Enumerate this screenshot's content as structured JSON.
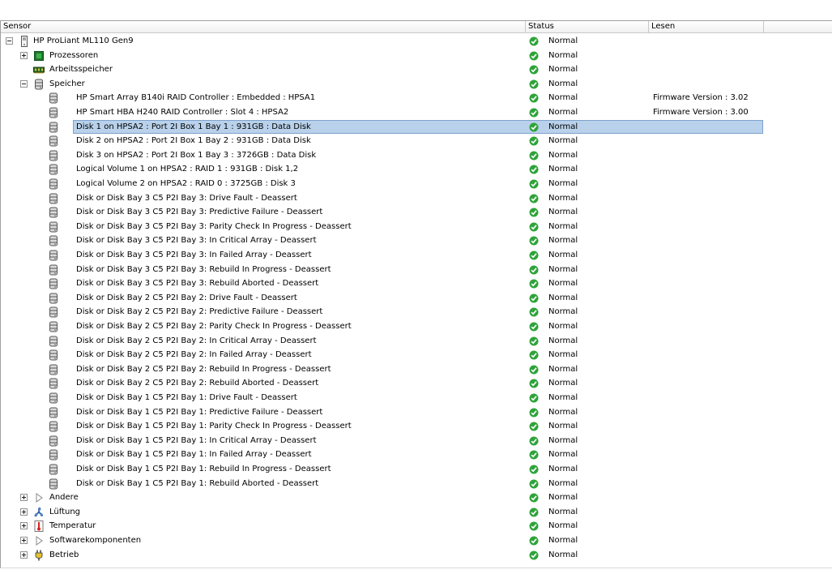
{
  "columns": {
    "sensor": "Sensor",
    "status": "Status",
    "reading": "Lesen"
  },
  "rows": [
    {
      "label": "HP ProLiant ML110 Gen9",
      "status": "Normal",
      "reading": "",
      "icon": "server-icon",
      "expander": "minus"
    },
    {
      "label": "Prozessoren",
      "status": "Normal",
      "reading": "",
      "icon": "processor-icon",
      "expander": "plus"
    },
    {
      "label": "Arbeitsspeicher",
      "status": "Normal",
      "reading": "",
      "icon": "memory-icon",
      "expander": ""
    },
    {
      "label": "Speicher",
      "status": "Normal",
      "reading": "",
      "icon": "disk-icon",
      "expander": "minus"
    },
    {
      "label": "HP Smart Array B140i RAID Controller : Embedded : HPSA1",
      "status": "Normal",
      "reading": "Firmware Version : 3.02",
      "icon": "disk-icon",
      "expander": ""
    },
    {
      "label": "HP Smart HBA H240 RAID Controller : Slot 4 : HPSA2",
      "status": "Normal",
      "reading": "Firmware Version : 3.00",
      "icon": "disk-icon",
      "expander": ""
    },
    {
      "label": "Disk 1 on HPSA2 : Port 2I Box 1 Bay 1 : 931GB : Data Disk",
      "status": "Normal",
      "reading": "",
      "icon": "disk-icon",
      "expander": "",
      "selected": true
    },
    {
      "label": "Disk 2 on HPSA2 : Port 2I Box 1 Bay 2 : 931GB : Data Disk",
      "status": "Normal",
      "reading": "",
      "icon": "disk-icon",
      "expander": ""
    },
    {
      "label": "Disk 3 on HPSA2 : Port 2I Box 1 Bay 3 : 3726GB : Data Disk",
      "status": "Normal",
      "reading": "",
      "icon": "disk-icon",
      "expander": ""
    },
    {
      "label": "Logical Volume 1 on HPSA2 : RAID 1 : 931GB : Disk 1,2",
      "status": "Normal",
      "reading": "",
      "icon": "disk-icon",
      "expander": ""
    },
    {
      "label": "Logical Volume 2 on HPSA2 : RAID 0 : 3725GB : Disk 3",
      "status": "Normal",
      "reading": "",
      "icon": "disk-icon",
      "expander": ""
    },
    {
      "label": "Disk or Disk Bay 3 C5 P2I Bay 3: Drive Fault - Deassert",
      "status": "Normal",
      "reading": "",
      "icon": "disk-icon",
      "expander": ""
    },
    {
      "label": "Disk or Disk Bay 3 C5 P2I Bay 3: Predictive Failure - Deassert",
      "status": "Normal",
      "reading": "",
      "icon": "disk-icon",
      "expander": ""
    },
    {
      "label": "Disk or Disk Bay 3 C5 P2I Bay 3: Parity Check In Progress - Deassert",
      "status": "Normal",
      "reading": "",
      "icon": "disk-icon",
      "expander": ""
    },
    {
      "label": "Disk or Disk Bay 3 C5 P2I Bay 3: In Critical Array - Deassert",
      "status": "Normal",
      "reading": "",
      "icon": "disk-icon",
      "expander": ""
    },
    {
      "label": "Disk or Disk Bay 3 C5 P2I Bay 3: In Failed Array - Deassert",
      "status": "Normal",
      "reading": "",
      "icon": "disk-icon",
      "expander": ""
    },
    {
      "label": "Disk or Disk Bay 3 C5 P2I Bay 3: Rebuild In Progress - Deassert",
      "status": "Normal",
      "reading": "",
      "icon": "disk-icon",
      "expander": ""
    },
    {
      "label": "Disk or Disk Bay 3 C5 P2I Bay 3: Rebuild Aborted - Deassert",
      "status": "Normal",
      "reading": "",
      "icon": "disk-icon",
      "expander": ""
    },
    {
      "label": "Disk or Disk Bay 2 C5 P2I Bay 2: Drive Fault - Deassert",
      "status": "Normal",
      "reading": "",
      "icon": "disk-icon",
      "expander": ""
    },
    {
      "label": "Disk or Disk Bay 2 C5 P2I Bay 2: Predictive Failure - Deassert",
      "status": "Normal",
      "reading": "",
      "icon": "disk-icon",
      "expander": ""
    },
    {
      "label": "Disk or Disk Bay 2 C5 P2I Bay 2: Parity Check In Progress - Deassert",
      "status": "Normal",
      "reading": "",
      "icon": "disk-icon",
      "expander": ""
    },
    {
      "label": "Disk or Disk Bay 2 C5 P2I Bay 2: In Critical Array - Deassert",
      "status": "Normal",
      "reading": "",
      "icon": "disk-icon",
      "expander": ""
    },
    {
      "label": "Disk or Disk Bay 2 C5 P2I Bay 2: In Failed Array - Deassert",
      "status": "Normal",
      "reading": "",
      "icon": "disk-icon",
      "expander": ""
    },
    {
      "label": "Disk or Disk Bay 2 C5 P2I Bay 2: Rebuild In Progress - Deassert",
      "status": "Normal",
      "reading": "",
      "icon": "disk-icon",
      "expander": ""
    },
    {
      "label": "Disk or Disk Bay 2 C5 P2I Bay 2: Rebuild Aborted - Deassert",
      "status": "Normal",
      "reading": "",
      "icon": "disk-icon",
      "expander": ""
    },
    {
      "label": "Disk or Disk Bay 1 C5 P2I Bay 1: Drive Fault - Deassert",
      "status": "Normal",
      "reading": "",
      "icon": "disk-icon",
      "expander": ""
    },
    {
      "label": "Disk or Disk Bay 1 C5 P2I Bay 1: Predictive Failure - Deassert",
      "status": "Normal",
      "reading": "",
      "icon": "disk-icon",
      "expander": ""
    },
    {
      "label": "Disk or Disk Bay 1 C5 P2I Bay 1: Parity Check In Progress - Deassert",
      "status": "Normal",
      "reading": "",
      "icon": "disk-icon",
      "expander": ""
    },
    {
      "label": "Disk or Disk Bay 1 C5 P2I Bay 1: In Critical Array - Deassert",
      "status": "Normal",
      "reading": "",
      "icon": "disk-icon",
      "expander": ""
    },
    {
      "label": "Disk or Disk Bay 1 C5 P2I Bay 1: In Failed Array - Deassert",
      "status": "Normal",
      "reading": "",
      "icon": "disk-icon",
      "expander": ""
    },
    {
      "label": "Disk or Disk Bay 1 C5 P2I Bay 1: Rebuild In Progress - Deassert",
      "status": "Normal",
      "reading": "",
      "icon": "disk-icon",
      "expander": ""
    },
    {
      "label": "Disk or Disk Bay 1 C5 P2I Bay 1: Rebuild Aborted - Deassert",
      "status": "Normal",
      "reading": "",
      "icon": "disk-icon",
      "expander": ""
    },
    {
      "label": "Andere",
      "status": "Normal",
      "reading": "",
      "icon": "other-icon",
      "expander": "plus"
    },
    {
      "label": "Lüftung",
      "status": "Normal",
      "reading": "",
      "icon": "fan-icon",
      "expander": "plus"
    },
    {
      "label": "Temperatur",
      "status": "Normal",
      "reading": "",
      "icon": "thermometer-icon",
      "expander": "plus"
    },
    {
      "label": "Softwarekomponenten",
      "status": "Normal",
      "reading": "",
      "icon": "other-icon",
      "expander": "plus"
    },
    {
      "label": "Betrieb",
      "status": "Normal",
      "reading": "",
      "icon": "power-plug-icon",
      "expander": "plus"
    }
  ],
  "colors": {
    "status_ok": "#2fa33a",
    "selection": "#b9d1ea",
    "selection_border": "#7da2ce"
  }
}
